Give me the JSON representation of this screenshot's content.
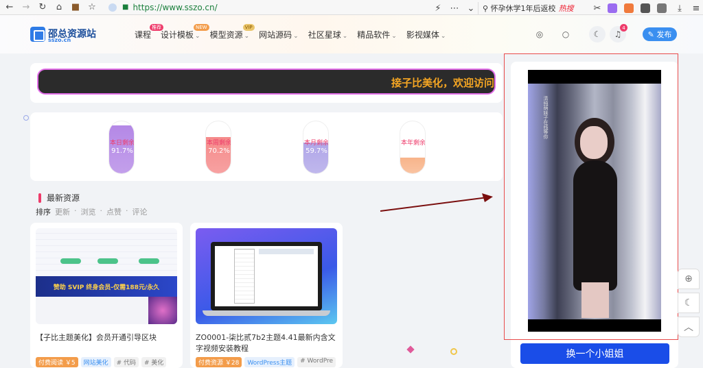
{
  "browser": {
    "url": "https://www.sszo.cn/",
    "search_text": "怀孕休学1年后返校",
    "search_hot": "热搜"
  },
  "site": {
    "logo_title": "邵总资源站",
    "logo_sub": "sszo.cn"
  },
  "nav": [
    {
      "label": "课程",
      "badge": "推荐",
      "badge_color": "#ee3b6a"
    },
    {
      "label": "设计模板",
      "badge": "NEW",
      "badge_color": "#f39c4a"
    },
    {
      "label": "模型资源",
      "badge": "VIP",
      "badge_color": "#e9c469"
    },
    {
      "label": "网站源码"
    },
    {
      "label": "社区星球"
    },
    {
      "label": "精品软件"
    },
    {
      "label": "影视媒体"
    }
  ],
  "header": {
    "notif_count": "4",
    "publish_label": "发布"
  },
  "notice_text": "接子比美化，欢迎访问",
  "stats": [
    {
      "label": "本日剩余",
      "pct": "91.7%",
      "value": 0.917,
      "color": "#b488e6"
    },
    {
      "label": "本周剩余",
      "pct": "70.2%",
      "value": 0.702,
      "color": "#f58a8a"
    },
    {
      "label": "本月剩余",
      "pct": "59.7%",
      "value": 0.597,
      "color": "#b0a6e8"
    },
    {
      "label": "本年剩余",
      "pct": "30.1%",
      "value": 0.301,
      "color": "#f8b48a"
    }
  ],
  "section": {
    "title": "最新资源"
  },
  "sort": [
    "排序",
    "更新",
    "浏览",
    "点赞",
    "评论"
  ],
  "cards": [
    {
      "title": "【子比主题美化】会员开通引导区块",
      "tags": [
        "付费阅读 ￥5",
        "网站美化",
        "# 代码",
        "# 美化"
      ],
      "thumb_text": "赞助 SVIP 终身会员-仅需188元/永久"
    },
    {
      "title": "ZO0001-柒比贰7b2主题4.41最新内含文字视频安装教程",
      "tags": [
        "付费资源 ￥28",
        "WordPress主题",
        "# WordPre"
      ]
    }
  ],
  "sidebar": {
    "video_caption": "清纯萌妹子在线等你",
    "button": "换一个小姐姐"
  }
}
